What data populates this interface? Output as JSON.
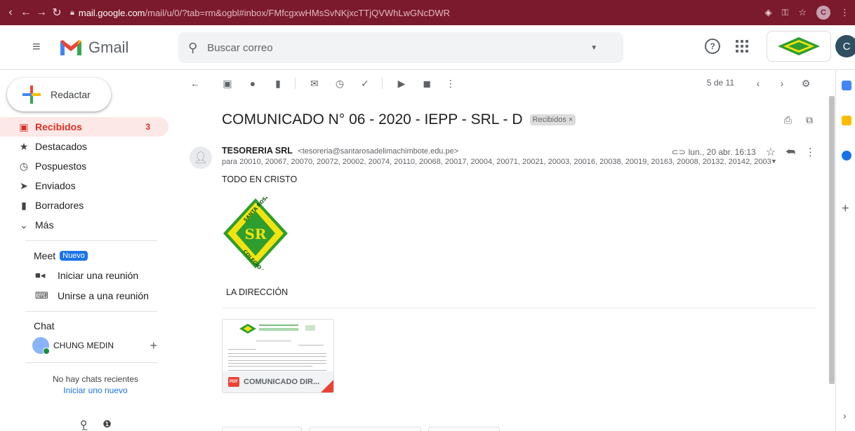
{
  "browser": {
    "host": "mail.google.com",
    "path": "/mail/u/0/?tab=rm&ogbl#inbox/FMfcgxwHMsSvNKjxcTTjQVWhLwGNcDWR",
    "profile_initial": "C"
  },
  "header": {
    "brand": "Gmail",
    "search_placeholder": "Buscar correo",
    "avatar_initial": "C"
  },
  "sidebar": {
    "compose_label": "Redactar",
    "items": [
      {
        "label": "Recibidos",
        "count": "3",
        "icon": "inbox-icon"
      },
      {
        "label": "Destacados",
        "icon": "star-icon"
      },
      {
        "label": "Pospuestos",
        "icon": "clock-icon"
      },
      {
        "label": "Enviados",
        "icon": "send-icon"
      },
      {
        "label": "Borradores",
        "icon": "draft-icon"
      },
      {
        "label": "Más",
        "icon": "chevron-down-icon"
      }
    ],
    "meet": {
      "title": "Meet",
      "badge": "Nuevo",
      "start": "Iniciar una reunión",
      "join": "Unirse a una reunión"
    },
    "chat": {
      "title": "Chat",
      "user": "CHUNG MEDIN",
      "no_chats": "No hay chats recientes",
      "start_new": "Iniciar uno nuevo"
    }
  },
  "toolbar": {
    "pager": "5 de 11"
  },
  "email": {
    "subject": "COMUNICADO N° 06 - 2020 - IEPP - SRL - D",
    "label_chip": "Recibidos ×",
    "sender_name": "TESORERIA SRL",
    "sender_email": "<tesoreria@santarosadelimachimbote.edu.pe>",
    "date": "lun., 20 abr. 16:13",
    "to": "para 20010, 20067, 20070, 20072, 20002, 20074, 20110, 20068, 20017, 20004, 20071, 20021, 20003, 20016, 20038, 20019, 20163, 20008, 20132, 20142, 2003",
    "greeting": "TODO EN CRISTO",
    "signature": "LA DIRECCIÓN",
    "attachment_name": "COMUNICADO DIR...",
    "attachment_type": "PDF",
    "logo_text_top": "SANTA ROSA DE LIMA",
    "logo_text_bottom": "COLEGIO CHIMBOTE",
    "logo_initials": "SR"
  },
  "colors": {
    "chrome_bar": "#7a1a2c",
    "active_red": "#d93025",
    "active_bg": "#fce8e6",
    "link_blue": "#1a73e8",
    "logo_green": "#2e9e2e",
    "logo_yellow": "#f2e311"
  }
}
